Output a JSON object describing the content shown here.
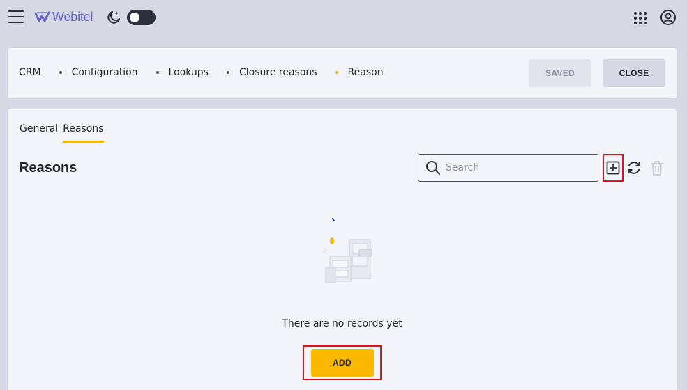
{
  "app": {
    "logo_text": "Webitel"
  },
  "icons": {
    "menu": "hamburger-menu-icon",
    "theme": "moon-stars-icon",
    "apps": "apps-grid-icon",
    "account": "account-circle-icon",
    "search": "search-icon",
    "add": "plus-square-icon",
    "refresh": "refresh-icon",
    "delete": "trash-icon"
  },
  "breadcrumb": [
    "CRM",
    "Configuration",
    "Lookups",
    "Closure reasons",
    "Reason"
  ],
  "header": {
    "saved_label": "SAVED",
    "close_label": "CLOSE"
  },
  "tabs": [
    {
      "label": "General",
      "active": false
    },
    {
      "label": "Reasons",
      "active": true
    }
  ],
  "section": {
    "title": "Reasons",
    "search_placeholder": "Search"
  },
  "empty_state": {
    "message": "There are no records yet",
    "add_label": "ADD"
  },
  "colors": {
    "accent": "#fbb800",
    "logo": "#6a63c9",
    "highlight_box": "#e0101d"
  }
}
